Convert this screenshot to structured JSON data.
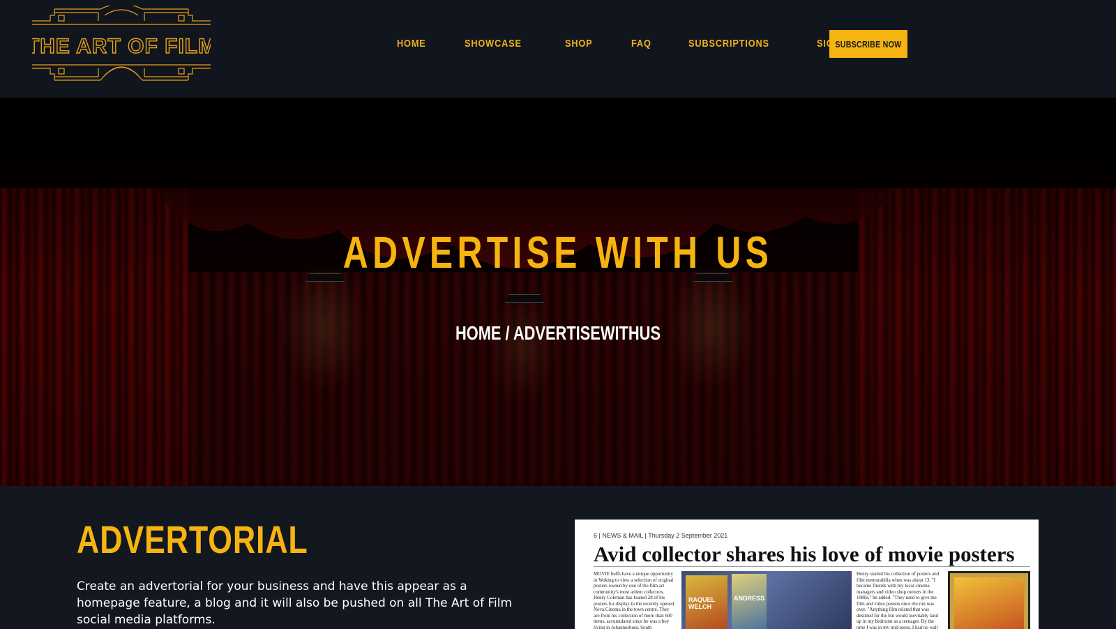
{
  "brand": {
    "name": "THE ART OF FILM",
    "accent": "#f5b40f"
  },
  "nav": {
    "items": [
      {
        "label": "HOME"
      },
      {
        "label": "SHOWCASE"
      },
      {
        "label": "SHOP"
      },
      {
        "label": "FAQ"
      },
      {
        "label": "SUBSCRIPTIONS"
      },
      {
        "label": "SIGN IN"
      }
    ],
    "cta_label": "SUBSCRIBE NOW"
  },
  "hero": {
    "title": "ADVERTISE WITH US",
    "breadcrumb": "HOME / ADVERTISEWITHUS"
  },
  "advertorial": {
    "title": "ADVERTORIAL",
    "text": "Create an advertorial for your business and have this appear as a homepage feature, a blog and it will also be pushed on all The Art of Film social media platforms."
  },
  "newspaper": {
    "header": "6  |  NEWS & MAIL  |  Thursday 2 September 2021",
    "headline": "Avid collector shares his love of movie posters",
    "col1": "MOVIE buffs have a unique opportunity in Woking to view a selection of original posters owned by one of the film art community's most ardent collectors. Henry Coleman has loaned 28 of his posters for display in the recently opened Nova Cinema in the town centre. They are from his collection of more than 600 items, accumulated since he was a boy living in Johannesburg, South",
    "col2": "Henry started his collection of posters and film memorabilia when was about 13. \"I became friends with my local cinema managers and video shop owners in the 1980s,\" he added. \"They used to give me film and video posters once the run was over. \"Anything film related that was destined for the bin would inevitably land up in my bedroom as a teenager. By the time I was in my mid-teens, I had no wall space or even",
    "poster1_label": "RAQUEL WELCH",
    "poster2_label": "ANDRESS"
  }
}
